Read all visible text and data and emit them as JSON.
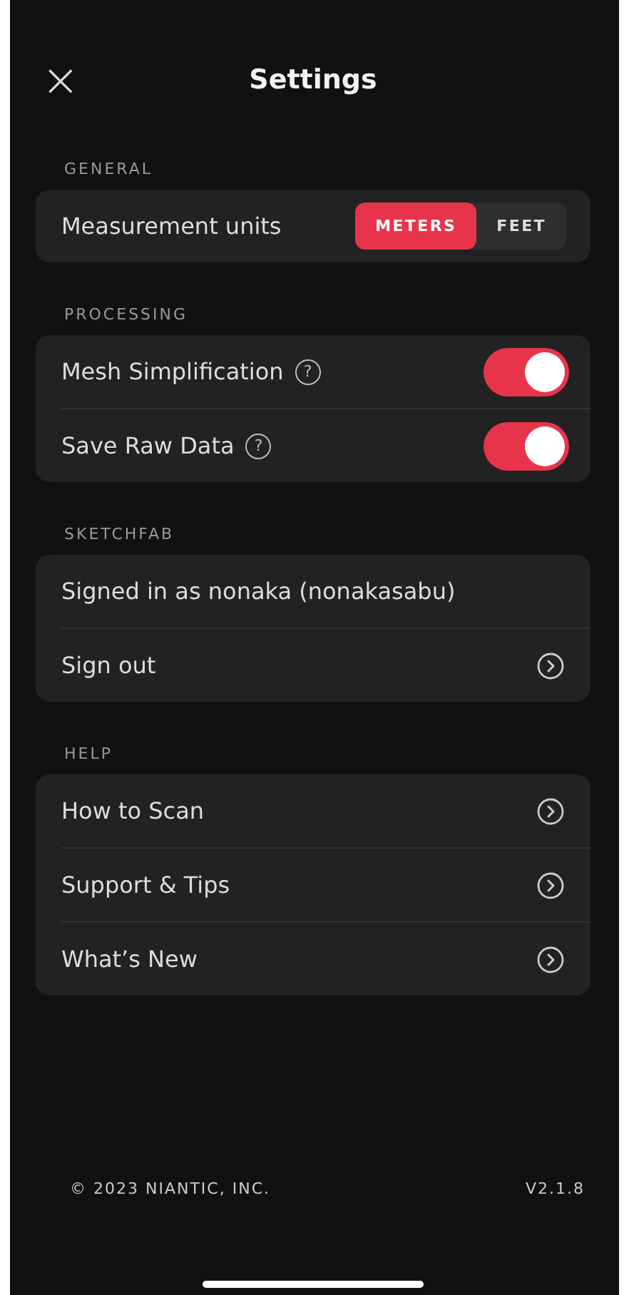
{
  "header": {
    "close": "×",
    "title": "Settings"
  },
  "sections": [
    {
      "heading": "GENERAL",
      "rows": [
        {
          "kind": "segmented",
          "label": "Measurement units",
          "options": [
            {
              "label": "METERS",
              "selected": true
            },
            {
              "label": "FEET",
              "selected": false
            }
          ]
        }
      ]
    },
    {
      "heading": "PROCESSING",
      "rows": [
        {
          "kind": "toggle",
          "label": "Mesh Simplification",
          "help": "?",
          "on": true
        },
        {
          "kind": "toggle",
          "label": "Save Raw Data",
          "help": "?",
          "on": true
        }
      ]
    },
    {
      "heading": "SKETCHFAB",
      "rows": [
        {
          "kind": "text",
          "label": "Signed in as nonaka (nonakasabu)"
        },
        {
          "kind": "link",
          "label": "Sign out"
        }
      ]
    },
    {
      "heading": "HELP",
      "rows": [
        {
          "kind": "link",
          "label": "How to Scan"
        },
        {
          "kind": "link",
          "label": "Support & Tips"
        },
        {
          "kind": "link",
          "label": "What’s New"
        }
      ]
    }
  ],
  "footer": {
    "copyright": "© 2023 NIANTIC, INC.",
    "version": "V2.1.8"
  }
}
